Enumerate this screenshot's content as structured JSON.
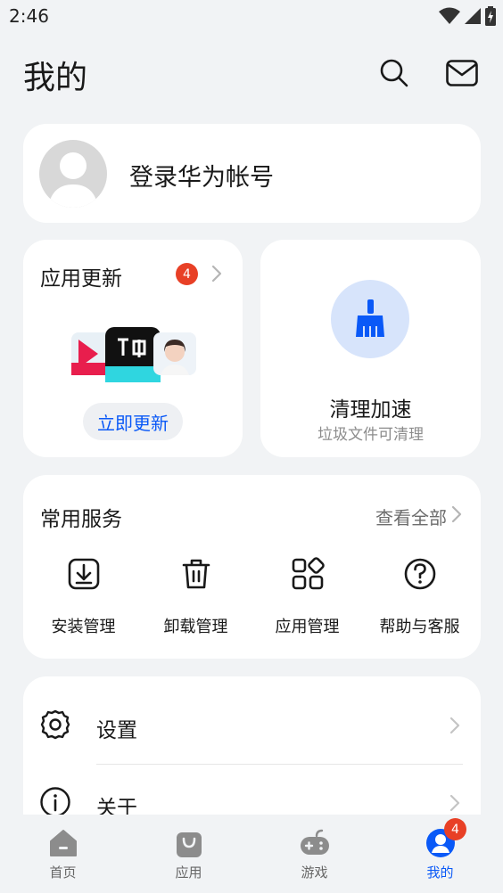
{
  "status": {
    "time": "2:46"
  },
  "header": {
    "title": "我的",
    "search_icon": "search-icon",
    "mail_icon": "mail-icon"
  },
  "account": {
    "login_label": "登录华为帐号"
  },
  "app_update": {
    "title": "应用更新",
    "badge_count": "4",
    "button_label": "立即更新"
  },
  "cleanup": {
    "title": "清理加速",
    "subtitle": "垃圾文件可清理"
  },
  "services": {
    "title": "常用服务",
    "more_label": "查看全部",
    "items": [
      {
        "label": "安装管理",
        "icon": "install-icon"
      },
      {
        "label": "卸载管理",
        "icon": "trash-icon"
      },
      {
        "label": "应用管理",
        "icon": "apps-grid-icon"
      },
      {
        "label": "帮助与客服",
        "icon": "help-icon"
      }
    ]
  },
  "settings_list": [
    {
      "label": "设置",
      "icon": "gear-icon"
    },
    {
      "label": "关于",
      "icon": "info-icon"
    }
  ],
  "bottom_nav": {
    "items": [
      {
        "label": "首页",
        "icon": "home-icon"
      },
      {
        "label": "应用",
        "icon": "bag-icon"
      },
      {
        "label": "游戏",
        "icon": "gamepad-icon"
      },
      {
        "label": "我的",
        "icon": "profile-icon"
      }
    ],
    "active_index": 3,
    "badge_count": "4"
  },
  "colors": {
    "accent": "#0a59f7",
    "badge": "#e84026",
    "background": "#f1f3f5",
    "card": "#ffffff"
  }
}
